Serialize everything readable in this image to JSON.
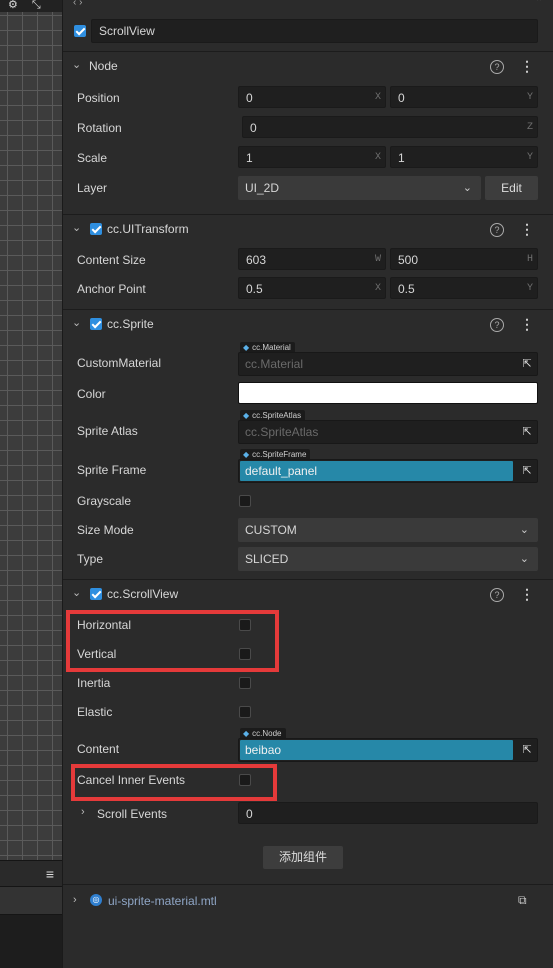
{
  "scene": {
    "settings_icon": "⚙",
    "transform_icon": "⤡",
    "menu_icon": "≡"
  },
  "inspector": {
    "node_name": "ScrollView",
    "node_section": {
      "title": "Node",
      "help": "?",
      "more": "⋮"
    },
    "position": {
      "label": "Position",
      "x": "0",
      "y": "0",
      "x_axis": "X",
      "y_axis": "Y"
    },
    "rotation": {
      "label": "Rotation",
      "z": "0",
      "z_axis": "Z"
    },
    "scale": {
      "label": "Scale",
      "x": "1",
      "y": "1",
      "x_axis": "X",
      "y_axis": "Y"
    },
    "layer": {
      "label": "Layer",
      "value": "UI_2D",
      "edit_label": "Edit"
    },
    "uitransform": {
      "title": "cc.UITransform",
      "content_size": {
        "label": "Content Size",
        "w": "603",
        "h": "500",
        "w_axis": "W",
        "h_axis": "H"
      },
      "anchor_point": {
        "label": "Anchor Point",
        "x": "0.5",
        "y": "0.5",
        "x_axis": "X",
        "y_axis": "Y"
      }
    },
    "sprite": {
      "title": "cc.Sprite",
      "custom_material": {
        "label": "CustomMaterial",
        "tag": "cc.Material",
        "placeholder": "cc.Material"
      },
      "color": {
        "label": "Color",
        "value": "#FFFFFF"
      },
      "sprite_atlas": {
        "label": "Sprite Atlas",
        "tag": "cc.SpriteAtlas",
        "placeholder": "cc.SpriteAtlas"
      },
      "sprite_frame": {
        "label": "Sprite Frame",
        "tag": "cc.SpriteFrame",
        "value": "default_panel"
      },
      "grayscale": {
        "label": "Grayscale",
        "checked": false
      },
      "size_mode": {
        "label": "Size Mode",
        "value": "CUSTOM"
      },
      "type": {
        "label": "Type",
        "value": "SLICED"
      }
    },
    "scrollview": {
      "title": "cc.ScrollView",
      "horizontal": {
        "label": "Horizontal",
        "checked": false
      },
      "vertical": {
        "label": "Vertical",
        "checked": false
      },
      "inertia": {
        "label": "Inertia",
        "checked": false
      },
      "elastic": {
        "label": "Elastic",
        "checked": false
      },
      "content": {
        "label": "Content",
        "tag": "cc.Node",
        "value": "beibao"
      },
      "cancel_inner_events": {
        "label": "Cancel Inner Events",
        "checked": false
      },
      "scroll_events": {
        "label": "Scroll Events",
        "value": "0"
      }
    },
    "add_component_label": "添加组件",
    "material_asset": {
      "name": "ui-sprite-material.mtl"
    }
  },
  "colors": {
    "accent": "#2f8fe0",
    "asset_fill": "#2688a8",
    "highlight": "#e53a3a"
  }
}
